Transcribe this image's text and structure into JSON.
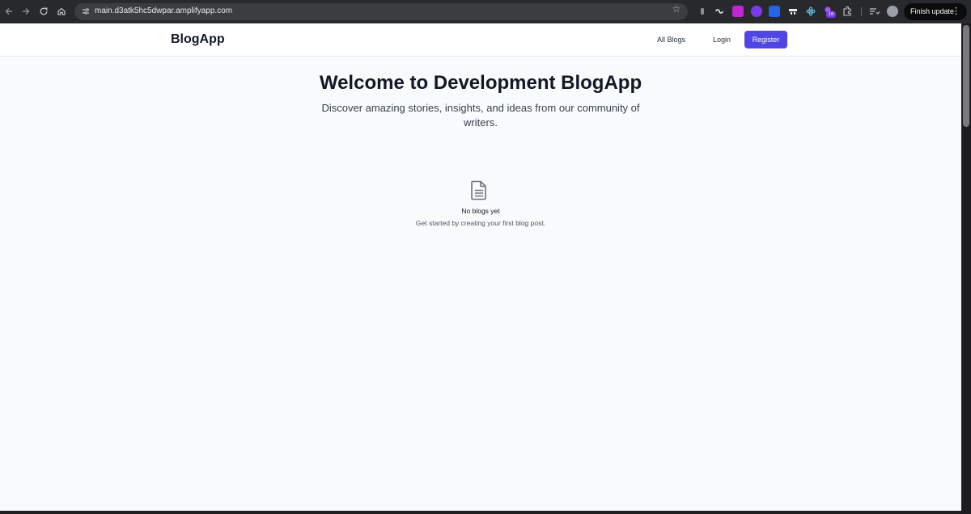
{
  "browser": {
    "url": "main.d3atk5hc5dwpar.amplifyapp.com",
    "update_label": "Finish update",
    "extension_badge": "16",
    "icons": [
      "back-icon",
      "forward-icon",
      "reload-icon",
      "home-icon",
      "site-info-icon",
      "bookmark-star-icon",
      "extensions-puzzle-icon",
      "profile-avatar-icon",
      "more-menu-icon"
    ]
  },
  "navbar": {
    "brand": "BlogApp",
    "links": [
      {
        "label": "All Blogs"
      },
      {
        "label": "Login"
      }
    ],
    "register_label": "Register"
  },
  "hero": {
    "title": "Welcome to Development BlogApp",
    "subtitle": "Discover amazing stories, insights, and ideas from our community of writers."
  },
  "empty_state": {
    "icon": "document-icon",
    "title": "No blogs yet",
    "subtitle": "Get started by creating your first blog post."
  },
  "colors": {
    "accent": "#4f46e5",
    "page_bg": "#f9fafb",
    "chrome_bg": "#28292c"
  }
}
